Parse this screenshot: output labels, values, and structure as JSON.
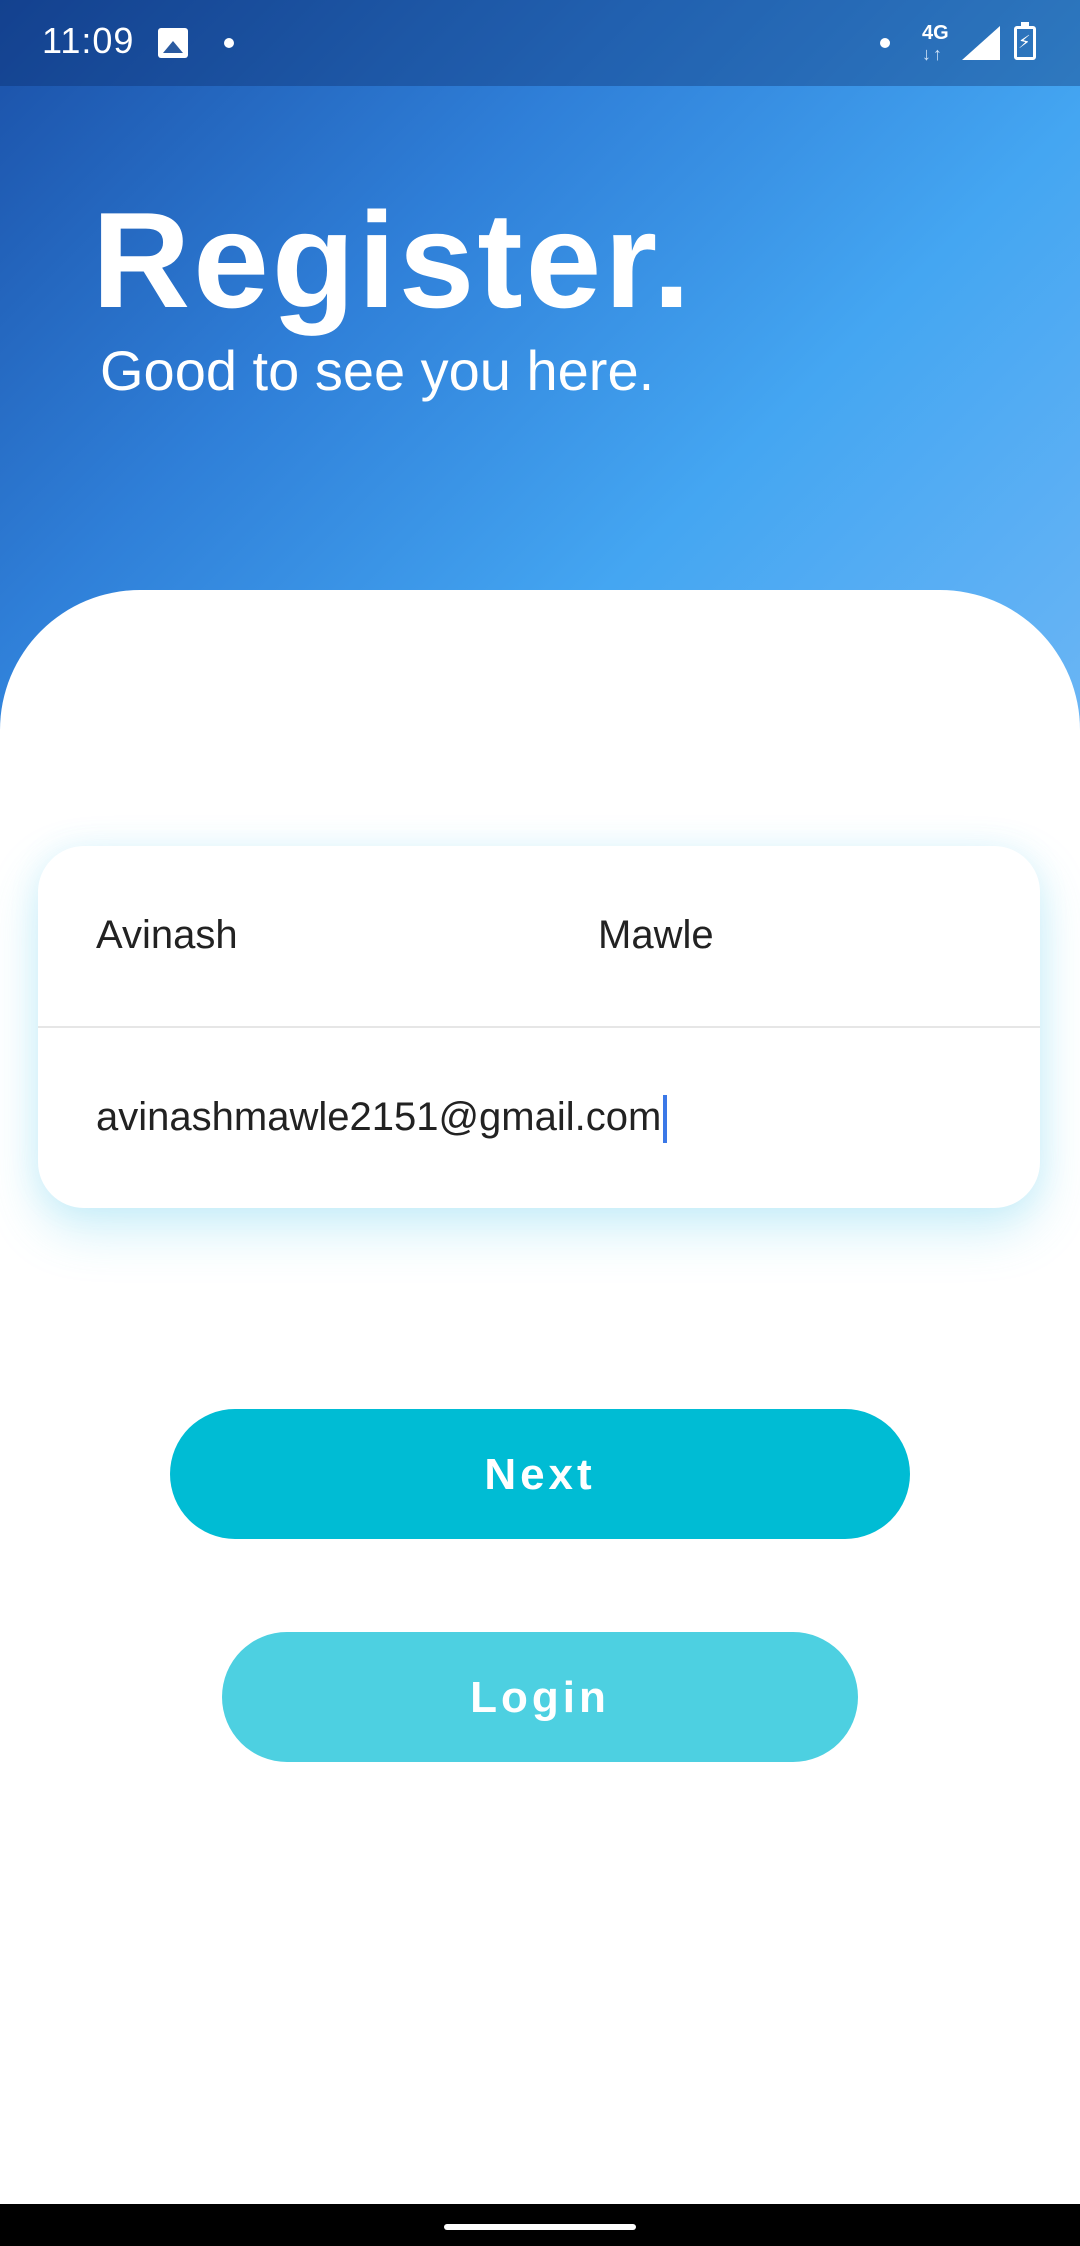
{
  "status_bar": {
    "time": "11:09",
    "network_label": "4G",
    "network_arrows": "↓↑"
  },
  "header": {
    "title": "Register.",
    "subtitle": "Good to see you here."
  },
  "form": {
    "first_name": "Avinash",
    "last_name": "Mawle",
    "email": "avinashmawle2151@gmail.com"
  },
  "buttons": {
    "next_label": "Next",
    "login_label": "Login"
  },
  "colors": {
    "primary": "#00bcd4",
    "secondary": "#4dd0e1",
    "header_gradient_start": "#1a4fa6",
    "header_gradient_end": "#6cb6f5",
    "caret": "#3b78e7"
  }
}
